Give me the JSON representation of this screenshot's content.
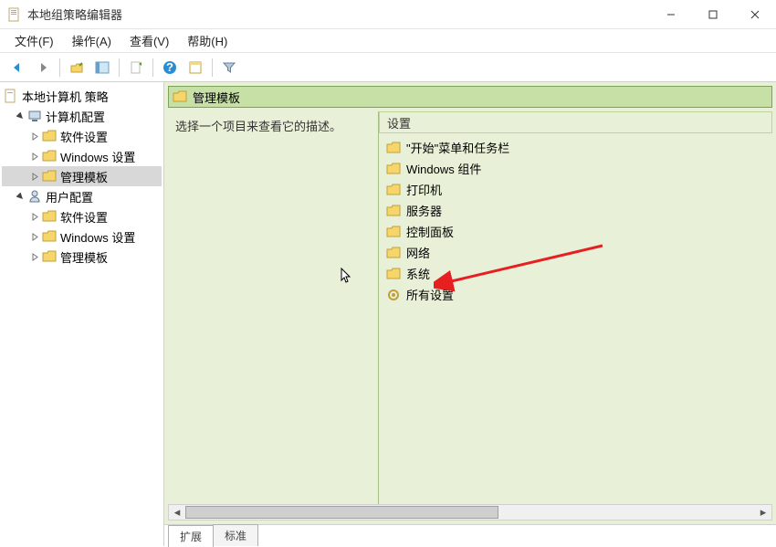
{
  "window": {
    "title": "本地组策略编辑器"
  },
  "menu": {
    "file": "文件(F)",
    "action": "操作(A)",
    "view": "查看(V)",
    "help": "帮助(H)"
  },
  "tree": {
    "root": "本地计算机 策略",
    "computer": "计算机配置",
    "comp_sw": "软件设置",
    "comp_win": "Windows 设置",
    "comp_adm": "管理模板",
    "user": "用户配置",
    "user_sw": "软件设置",
    "user_win": "Windows 设置",
    "user_adm": "管理模板"
  },
  "content": {
    "path_label": "管理模板",
    "desc_prompt": "选择一个项目来查看它的描述。",
    "settings_header": "设置",
    "items": {
      "start": "\"开始\"菜单和任务栏",
      "wincomp": "Windows 组件",
      "printer": "打印机",
      "server": "服务器",
      "ctrlpanel": "控制面板",
      "network": "网络",
      "system": "系统",
      "allset": "所有设置"
    }
  },
  "tabs": {
    "ext": "扩展",
    "std": "标准"
  }
}
